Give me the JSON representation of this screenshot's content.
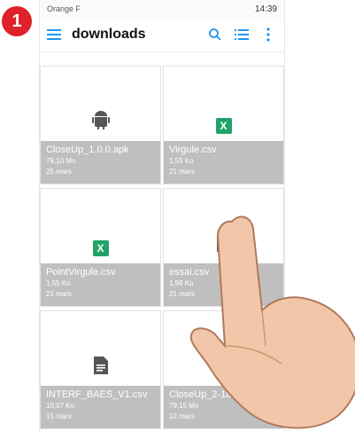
{
  "step_badge": "1",
  "status_bar": {
    "carrier": "Orange F",
    "time_cluster": "14:39"
  },
  "appbar": {
    "title": "downloads",
    "icons": [
      "hamburger-menu-icon",
      "search-icon",
      "list-view-icon",
      "more-vert-icon"
    ],
    "accent": "#2196f3"
  },
  "files": [
    {
      "name": "CloseUp_1.0.0.apk",
      "size": "79,10 Mo",
      "date": "25 mars",
      "icon": "android-icon"
    },
    {
      "name": "Virgule.csv",
      "size": "1,55 Ko",
      "date": "21 mars",
      "icon": "excel-icon"
    },
    {
      "name": "PointVirgule.csv",
      "size": "1,55 Ko",
      "date": "21 mars",
      "icon": "excel-icon"
    },
    {
      "name": "essai.csv",
      "size": "1,98 Ko",
      "date": "21 mars",
      "icon": "document-icon"
    },
    {
      "name": "INTERF_BAES_V1.csv",
      "size": "10,07 Ko",
      "date": "15 mars",
      "icon": "document-icon"
    },
    {
      "name": "CloseUp_2-18-1.apk",
      "size": "79,15 Mo",
      "date": "12 mars",
      "icon": "android-icon"
    }
  ],
  "excel_icon_letter": "X"
}
